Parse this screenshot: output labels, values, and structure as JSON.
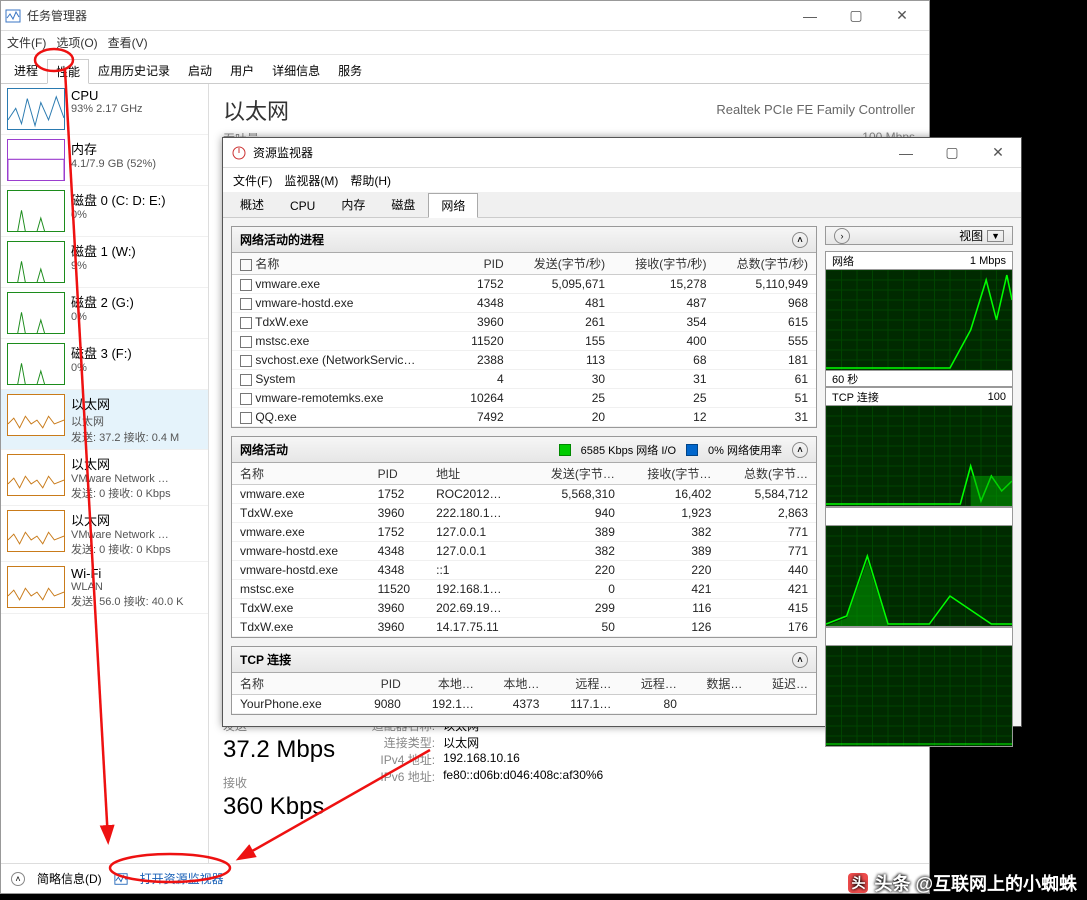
{
  "task_manager": {
    "title": "任务管理器",
    "menus": [
      "文件(F)",
      "选项(O)",
      "查看(V)"
    ],
    "tabs": [
      "进程",
      "性能",
      "应用历史记录",
      "启动",
      "用户",
      "详细信息",
      "服务"
    ],
    "active_tab": 1,
    "sidebar": [
      {
        "title": "CPU",
        "sub": "93%  2.17 GHz",
        "color": "blue"
      },
      {
        "title": "内存",
        "sub": "4.1/7.9 GB (52%)",
        "color": "purple"
      },
      {
        "title": "磁盘 0 (C: D: E:)",
        "sub": "0%",
        "color": "green"
      },
      {
        "title": "磁盘 1 (W:)",
        "sub": "9%",
        "color": "green"
      },
      {
        "title": "磁盘 2 (G:)",
        "sub": "0%",
        "color": "green"
      },
      {
        "title": "磁盘 3 (F:)",
        "sub": "0%",
        "color": "green"
      },
      {
        "title": "以太网",
        "sub1": "以太网",
        "sub2": "发送: 37.2  接收: 0.4 M",
        "color": "orange",
        "selected": true
      },
      {
        "title": "以太网",
        "sub1": "VMware Network …",
        "sub2": "发送: 0  接收: 0 Kbps",
        "color": "orange"
      },
      {
        "title": "以太网",
        "sub1": "VMware Network …",
        "sub2": "发送: 0  接收: 0 Kbps",
        "color": "orange"
      },
      {
        "title": "Wi-Fi",
        "sub1": "WLAN",
        "sub2": "发送: 56.0  接收: 40.0 K",
        "color": "orange"
      }
    ],
    "main": {
      "heading": "以太网",
      "adapter": "Realtek PCIe FE Family Controller",
      "throughput_label": "吞吐量",
      "link_speed": "100 Mbps",
      "stats": {
        "send_label": "发送",
        "send_value": "37.2 Mbps",
        "recv_label": "接收",
        "recv_value": "360 Kbps",
        "props": [
          {
            "k": "适配器名称:",
            "v": "以太网"
          },
          {
            "k": "连接类型:",
            "v": "以太网"
          },
          {
            "k": "IPv4 地址:",
            "v": "192.168.10.16"
          },
          {
            "k": "IPv6 地址:",
            "v": "fe80::d06b:d046:408c:af30%6"
          }
        ]
      }
    },
    "footer": {
      "less": "简略信息(D)",
      "open_rm": "打开资源监视器"
    }
  },
  "resource_monitor": {
    "title": "资源监视器",
    "menus": [
      "文件(F)",
      "监视器(M)",
      "帮助(H)"
    ],
    "tabs": [
      "概述",
      "CPU",
      "内存",
      "磁盘",
      "网络"
    ],
    "active_tab": 4,
    "panel1": {
      "title": "网络活动的进程",
      "headers": [
        "名称",
        "PID",
        "发送(字节/秒)",
        "接收(字节/秒)",
        "总数(字节/秒)"
      ],
      "rows": [
        [
          "vmware.exe",
          "1752",
          "5,095,671",
          "15,278",
          "5,110,949"
        ],
        [
          "vmware-hostd.exe",
          "4348",
          "481",
          "487",
          "968"
        ],
        [
          "TdxW.exe",
          "3960",
          "261",
          "354",
          "615"
        ],
        [
          "mstsc.exe",
          "11520",
          "155",
          "400",
          "555"
        ],
        [
          "svchost.exe (NetworkServic…",
          "2388",
          "113",
          "68",
          "181"
        ],
        [
          "System",
          "4",
          "30",
          "31",
          "61"
        ],
        [
          "vmware-remotemks.exe",
          "10264",
          "25",
          "25",
          "51"
        ],
        [
          "QQ.exe",
          "7492",
          "20",
          "12",
          "31"
        ]
      ]
    },
    "panel2": {
      "title": "网络活动",
      "legend1": "6585 Kbps 网络 I/O",
      "legend2": "0% 网络使用率",
      "headers": [
        "名称",
        "PID",
        "地址",
        "发送(字节…",
        "接收(字节…",
        "总数(字节…"
      ],
      "rows": [
        [
          "vmware.exe",
          "1752",
          "ROC2012…",
          "5,568,310",
          "16,402",
          "5,584,712"
        ],
        [
          "TdxW.exe",
          "3960",
          "222.180.1…",
          "940",
          "1,923",
          "2,863"
        ],
        [
          "vmware.exe",
          "1752",
          "127.0.0.1",
          "389",
          "382",
          "771"
        ],
        [
          "vmware-hostd.exe",
          "4348",
          "127.0.0.1",
          "382",
          "389",
          "771"
        ],
        [
          "vmware-hostd.exe",
          "4348",
          "::1",
          "220",
          "220",
          "440"
        ],
        [
          "mstsc.exe",
          "11520",
          "192.168.1…",
          "0",
          "421",
          "421"
        ],
        [
          "TdxW.exe",
          "3960",
          "202.69.19…",
          "299",
          "116",
          "415"
        ],
        [
          "TdxW.exe",
          "3960",
          "14.17.75.11",
          "50",
          "126",
          "176"
        ]
      ]
    },
    "panel3": {
      "title": "TCP 连接",
      "headers": [
        "名称",
        "PID",
        "本地…",
        "本地…",
        "远程…",
        "远程…",
        "数据…",
        "延迟…"
      ],
      "rows": [
        [
          "YourPhone.exe",
          "9080",
          "192.1…",
          "4373",
          "117.1…",
          "80",
          "",
          ""
        ]
      ]
    },
    "charts_view_label": "视图",
    "charts": [
      {
        "title": "网络",
        "right": "1 Mbps",
        "foot": "60 秒"
      },
      {
        "title": "TCP 连接",
        "right": "100",
        "foot": ""
      },
      {
        "title": "",
        "right": "",
        "foot": ""
      },
      {
        "title": "",
        "right": "",
        "foot": ""
      }
    ]
  },
  "watermark": "头条 @互联网上的小蜘蛛"
}
